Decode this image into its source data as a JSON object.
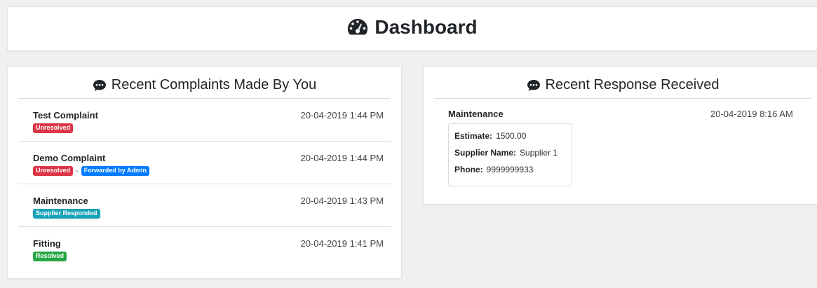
{
  "header": {
    "title": "Dashboard",
    "icon": "tachometer-icon"
  },
  "complaints": {
    "title": "Recent Complaints Made By You",
    "icon": "comment-icon",
    "items": [
      {
        "name": "Test Complaint",
        "date": "20-04-2019 1:44 PM",
        "badges": [
          {
            "label": "Unresolved",
            "color": "#dc3545"
          }
        ]
      },
      {
        "name": "Demo Complaint",
        "date": "20-04-2019 1:44 PM",
        "badges": [
          {
            "label": "Unresolved",
            "color": "#dc3545"
          },
          {
            "label": "Forwarded by Admin",
            "color": "#007bff"
          }
        ],
        "separator": "-"
      },
      {
        "name": "Maintenance",
        "date": "20-04-2019 1:43 PM",
        "badges": [
          {
            "label": "Supplier Responded",
            "color": "#17a2b8"
          }
        ]
      },
      {
        "name": "Fitting",
        "date": "20-04-2019 1:41 PM",
        "badges": [
          {
            "label": "Resolved",
            "color": "#28a745"
          }
        ]
      }
    ]
  },
  "responses": {
    "title": "Recent Response Received",
    "icon": "comment-icon",
    "item": {
      "name": "Maintenance",
      "date": "20-04-2019 8:16 AM",
      "estimate_label": "Estimate:",
      "estimate_value": "1500.00",
      "supplier_label": "Supplier Name:",
      "supplier_value": "Supplier 1",
      "phone_label": "Phone:",
      "phone_value": "9999999933"
    }
  }
}
